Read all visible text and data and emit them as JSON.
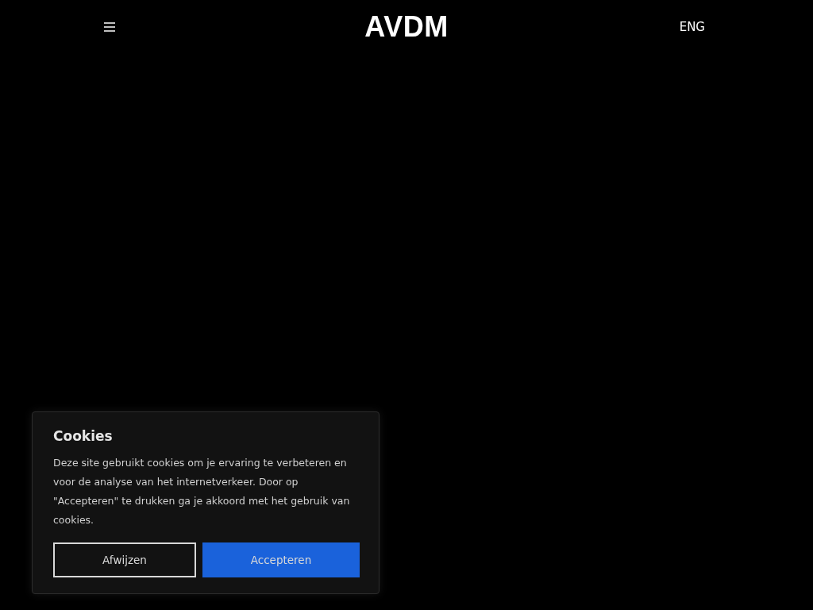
{
  "header": {
    "logo": "AVDM",
    "language": "ENG"
  },
  "cookie_banner": {
    "title": "Cookies",
    "text": "Deze site gebruikt cookies om je ervaring te verbeteren en voor de analyse van het internetverkeer. Door op \"Accepteren\" te drukken ga je akkoord met het gebruik van cookies.",
    "buttons": [
      {
        "label": "Afwijzen",
        "kind": "outline"
      },
      {
        "label": "Accepteren",
        "kind": "primary"
      }
    ]
  }
}
